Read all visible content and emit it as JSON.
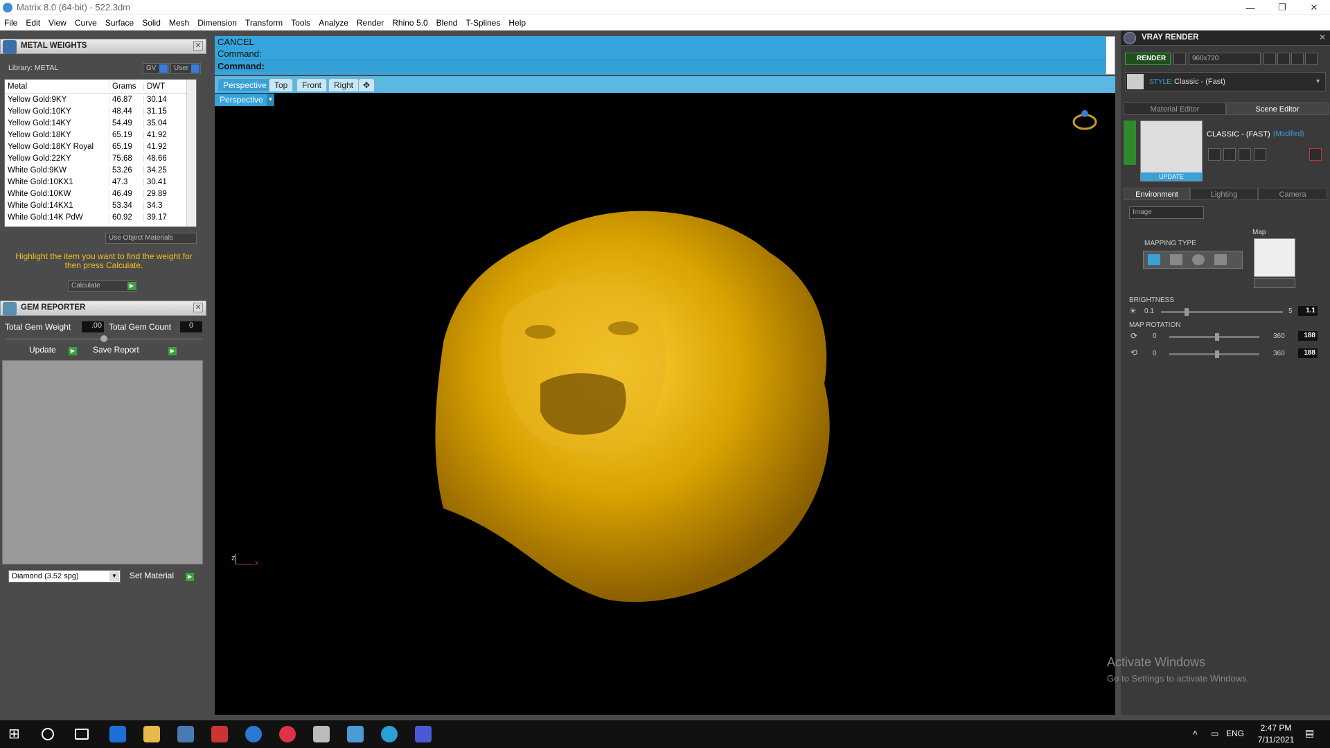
{
  "window": {
    "title": "Matrix 8.0 (64-bit) - 522.3dm",
    "minimize": "—",
    "restore": "❐",
    "close": "✕"
  },
  "menu": [
    "File",
    "Edit",
    "View",
    "Curve",
    "Surface",
    "Solid",
    "Mesh",
    "Dimension",
    "Transform",
    "Tools",
    "Analyze",
    "Render",
    "Rhino 5.0",
    "Blend",
    "T-Splines",
    "Help"
  ],
  "metal_weights": {
    "title": "METAL WEIGHTS",
    "library_label": "Library: METAL",
    "gv_label": "GV",
    "user_label": "User",
    "columns": [
      "Metal",
      "Grams",
      "DWT"
    ],
    "rows": [
      [
        "Yellow Gold:9KY",
        "46.87",
        "30.14"
      ],
      [
        "Yellow Gold:10KY",
        "48.44",
        "31.15"
      ],
      [
        "Yellow Gold:14KY",
        "54.49",
        "35.04"
      ],
      [
        "Yellow Gold:18KY",
        "65.19",
        "41.92"
      ],
      [
        "Yellow Gold:18KY Royal",
        "65.19",
        "41.92"
      ],
      [
        "Yellow Gold:22KY",
        "75.68",
        "48.66"
      ],
      [
        "White Gold:9KW",
        "53.26",
        "34.25"
      ],
      [
        "White Gold:10KX1",
        "47.3",
        "30.41"
      ],
      [
        "White Gold:10KW",
        "46.49",
        "29.89"
      ],
      [
        "White Gold:14KX1",
        "53.34",
        "34.3"
      ],
      [
        "White Gold:14K PdW",
        "60.92",
        "39.17"
      ]
    ],
    "use_object_materials": "Use Object Materials",
    "hint": "Highlight the item you want to find the weight for then press Calculate.",
    "calculate": "Calculate"
  },
  "gem_reporter": {
    "title": "GEM REPORTER",
    "total_weight_label": "Total Gem Weight",
    "total_weight_value": ".00",
    "total_count_label": "Total Gem Count",
    "total_count_value": "0",
    "update_label": "Update",
    "save_report_label": "Save Report",
    "material_select": "Diamond     (3.52 spg)",
    "set_material_label": "Set Material"
  },
  "command": {
    "line1": "CANCEL",
    "line2": "Command:",
    "line3": "Command:"
  },
  "viewport_tabs": [
    "Perspective",
    "Top",
    "Front",
    "Right"
  ],
  "viewport_label": "Perspective",
  "axis_label": "z",
  "axis_x": "x",
  "vray": {
    "title": "VRAY RENDER",
    "render_button": "RENDER",
    "resolution": "960x720",
    "style_label": "STYLE:",
    "style_value": "Classic - (Fast)",
    "tab_material": "Material Editor",
    "tab_scene": "Scene Editor",
    "scene_name": "CLASSIC - (FAST)",
    "scene_modified": "(Modified)",
    "update_label": "UPDATE",
    "subtabs": [
      "Environment",
      "Lighting",
      "Camera"
    ],
    "env_type": "Image",
    "mapping_type": "MAPPING TYPE",
    "map_label": "Map",
    "brightness_label": "BRIGHTNESS",
    "brightness_min": "0.1",
    "brightness_max": "5",
    "brightness_value": "1.1",
    "map_rotation_label": "MAP ROTATION",
    "rot_min": "0",
    "rot_max": "360",
    "rot1_value": "188",
    "rot2_value": "188"
  },
  "activate": {
    "line1": "Activate Windows",
    "line2": "Go to Settings to activate Windows."
  },
  "taskbar": {
    "lang": "ENG",
    "time": "2:47 PM",
    "date": "7/11/2021"
  }
}
